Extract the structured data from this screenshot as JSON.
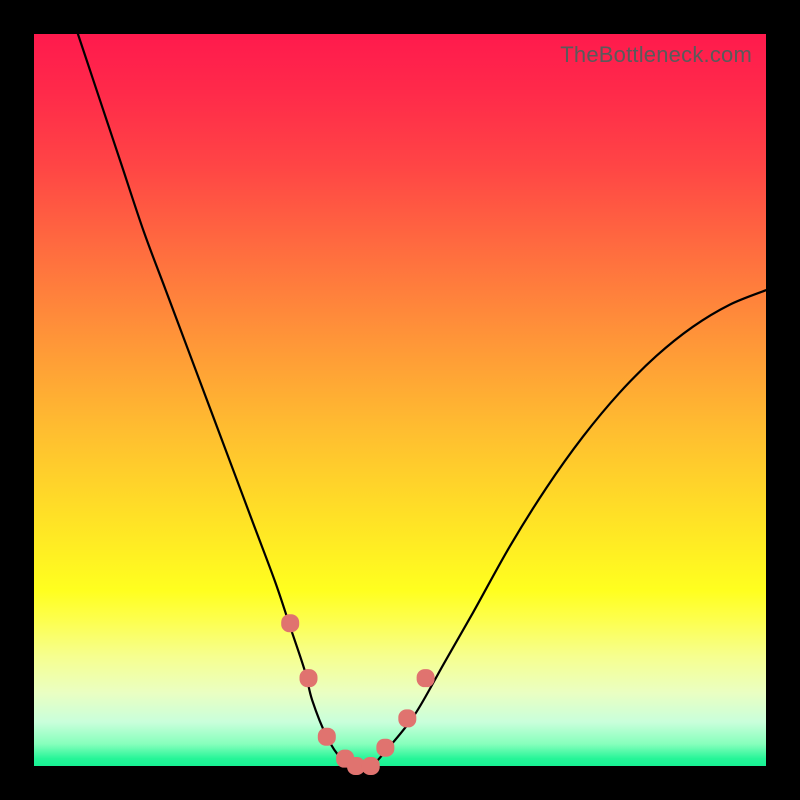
{
  "watermark": "TheBottleneck.com",
  "chart_data": {
    "type": "line",
    "title": "",
    "xlabel": "",
    "ylabel": "",
    "xlim": [
      0,
      100
    ],
    "ylim": [
      0,
      100
    ],
    "series": [
      {
        "name": "bottleneck-curve",
        "x": [
          6,
          8,
          10,
          12,
          15,
          18,
          21,
          24,
          27,
          30,
          33,
          35,
          37,
          38,
          40,
          42,
          44,
          46,
          48,
          52,
          56,
          60,
          65,
          70,
          75,
          80,
          85,
          90,
          95,
          100
        ],
        "y": [
          100,
          94,
          88,
          82,
          73,
          65,
          57,
          49,
          41,
          33,
          25,
          19,
          13,
          9,
          4,
          1,
          0,
          0,
          2,
          7,
          14,
          21,
          30,
          38,
          45,
          51,
          56,
          60,
          63,
          65
        ]
      }
    ],
    "highlight": {
      "name": "near-minimum-markers",
      "x": [
        35,
        37.5,
        40,
        42.5,
        44,
        46,
        48,
        51,
        53.5
      ],
      "y": [
        19.5,
        12,
        4,
        1,
        0,
        0,
        2.5,
        6.5,
        12
      ]
    },
    "gradient_stops": [
      {
        "pos": 0.0,
        "color": "#ff1a4d"
      },
      {
        "pos": 0.5,
        "color": "#ffcf2a"
      },
      {
        "pos": 0.78,
        "color": "#ffff1f"
      },
      {
        "pos": 0.99,
        "color": "#26f598"
      }
    ]
  }
}
